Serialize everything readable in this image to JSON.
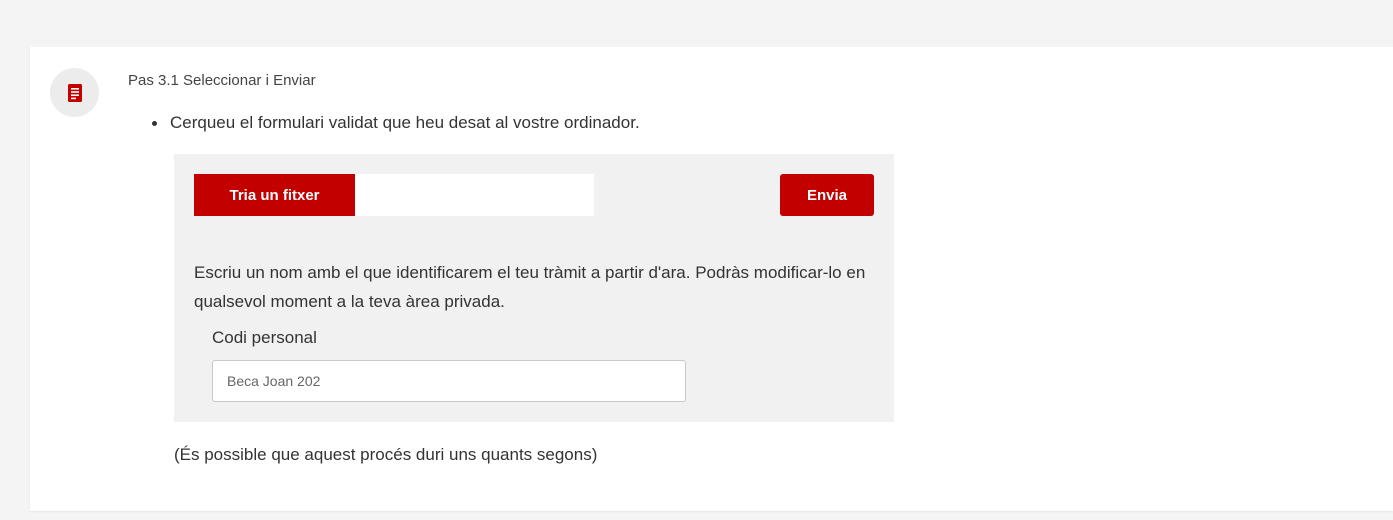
{
  "step": {
    "icon": "document-icon",
    "title": "Pas 3.1 Seleccionar i Enviar",
    "instruction": "Cerqueu el formulari validat que heu desat al vostre ordinador."
  },
  "upload": {
    "choose_file_label": "Tria un fitxer",
    "file_name": "",
    "send_label": "Envia"
  },
  "naming": {
    "description": "Escriu un nom amb el que identificarem el teu tràmit a partir d'ara. Podràs modificar-lo en qualsevol moment a la teva àrea privada.",
    "field_label": "Codi personal",
    "field_value": "",
    "field_placeholder": "Beca Joan 202"
  },
  "note": "(És possible que aquest procés duri uns quants segons)",
  "colors": {
    "accent": "#c20000",
    "page_background": "#f4f4f4",
    "panel_background": "#f1f1f1"
  }
}
